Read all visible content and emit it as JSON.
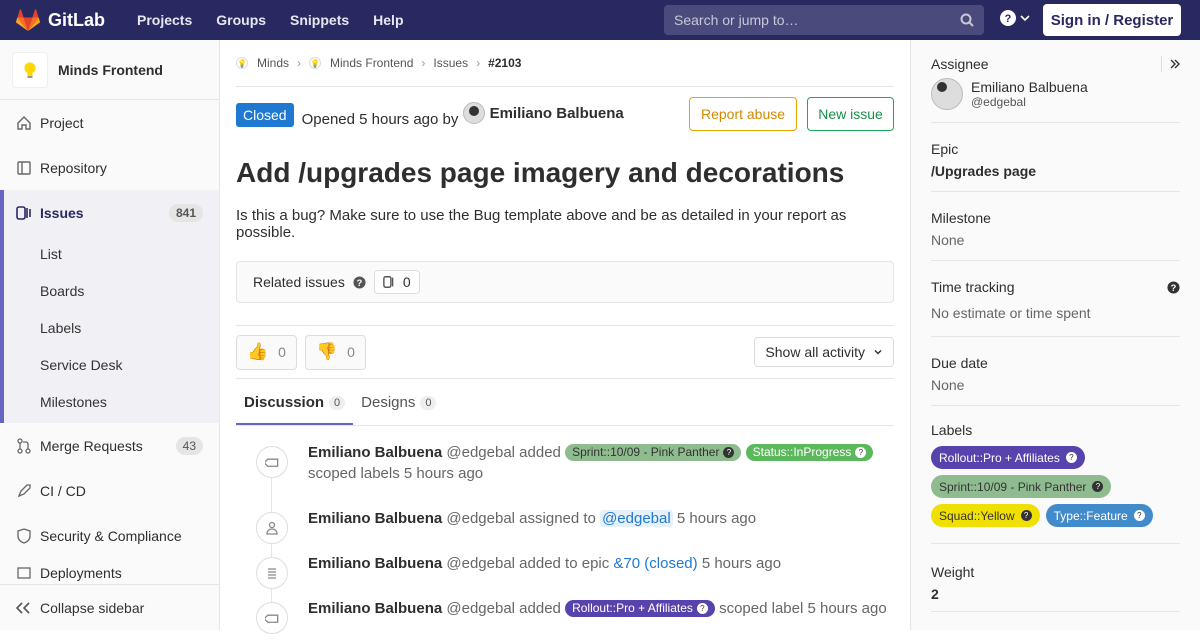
{
  "nav": {
    "brand": "GitLab",
    "links": [
      "Projects",
      "Groups",
      "Snippets",
      "Help"
    ],
    "search_placeholder": "Search or jump to…",
    "signin": "Sign in / Register"
  },
  "sidebar": {
    "project": "Minds Frontend",
    "items_top": [
      {
        "label": "Project",
        "icon": "home-icon"
      },
      {
        "label": "Repository",
        "icon": "repo-icon"
      }
    ],
    "issues": {
      "label": "Issues",
      "count": "841",
      "sub": [
        "List",
        "Boards",
        "Labels",
        "Service Desk",
        "Milestones"
      ]
    },
    "items_bottom": [
      {
        "label": "Merge Requests",
        "count": "43",
        "icon": "merge-icon"
      },
      {
        "label": "CI / CD",
        "icon": "rocket-icon"
      },
      {
        "label": "Security & Compliance",
        "icon": "shield-icon"
      },
      {
        "label": "Deployments",
        "icon": "deploy-icon"
      }
    ],
    "collapse": "Collapse sidebar"
  },
  "breadcrumbs": {
    "group": "Minds",
    "project": "Minds Frontend",
    "section": "Issues",
    "current": "#2103"
  },
  "issue": {
    "status": "Closed",
    "opened": "Opened 5 hours ago by",
    "author": "Emiliano Balbuena",
    "report": "Report abuse",
    "new": "New issue",
    "title": "Add /upgrades page imagery and decorations",
    "description": "Is this a bug? Make sure to use the Bug template above and be as detailed in your report as possible.",
    "related_label": "Related issues",
    "related_count": "0",
    "thumbs_up": "0",
    "thumbs_down": "0",
    "activity_filter": "Show all activity",
    "tabs": [
      {
        "label": "Discussion",
        "count": "0"
      },
      {
        "label": "Designs",
        "count": "0"
      }
    ]
  },
  "notes": [
    {
      "author": "Emiliano Balbuena",
      "handle": "@edgebal",
      "action": "added",
      "labels": [
        "Sprint::10/09 - Pink Panther",
        "Status::InProgress"
      ],
      "tail": "scoped labels 5 hours ago"
    },
    {
      "author": "Emiliano Balbuena",
      "handle": "@edgebal",
      "action": "assigned to",
      "mention": "@edgebal",
      "time": "5 hours ago"
    },
    {
      "author": "Emiliano Balbuena",
      "handle": "@edgebal",
      "action": "added to epic",
      "epic": "&70 (closed)",
      "time": "5 hours ago"
    },
    {
      "author": "Emiliano Balbuena",
      "handle": "@edgebal",
      "action": "added",
      "label": "Rollout::Pro + Affiliates",
      "tail": "scoped label 5 hours ago"
    }
  ],
  "right": {
    "assignee_title": "Assignee",
    "assignee_name": "Emiliano Balbuena",
    "assignee_handle": "@edgebal",
    "epic_title": "Epic",
    "epic_value": "/Upgrades page",
    "milestone_title": "Milestone",
    "milestone_value": "None",
    "time_title": "Time tracking",
    "time_value": "No estimate or time spent",
    "due_title": "Due date",
    "due_value": "None",
    "labels_title": "Labels",
    "labels": [
      {
        "text": "Rollout::Pro + Affiliates",
        "bg": "#5843ad",
        "fg": "#ffffff"
      },
      {
        "text": "Sprint::10/09 - Pink Panther",
        "bg": "#8fbc8f",
        "fg": "#333333"
      },
      {
        "text": "Squad::Yellow",
        "bg": "#f0e000",
        "fg": "#333333"
      },
      {
        "text": "Type::Feature",
        "bg": "#428bca",
        "fg": "#ffffff"
      }
    ],
    "weight_title": "Weight",
    "weight_value": "2"
  },
  "colors": {
    "nav": "#292961",
    "closed": "#1f78d1",
    "accent": "#6666c4"
  }
}
